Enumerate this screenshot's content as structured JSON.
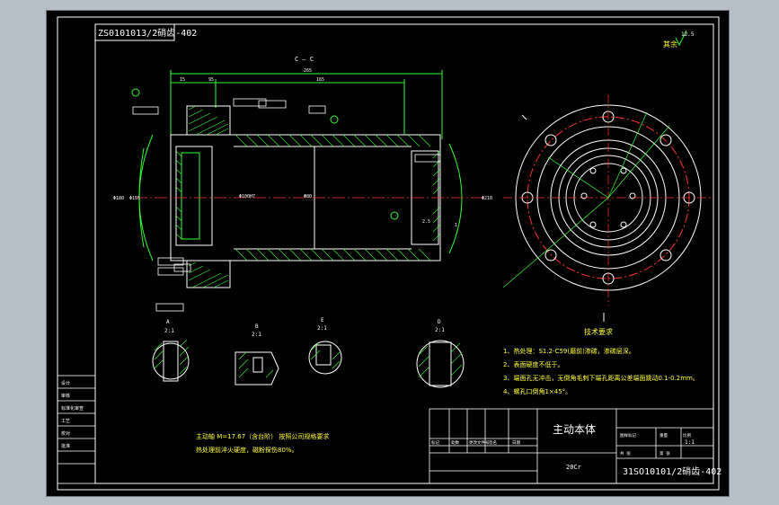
{
  "drawing": {
    "drawing_no_rotated": "ZS0101013/2硝齿-402",
    "section_label": "C — C",
    "roughness_other_label": "其余",
    "roughness_other_value": "12.5",
    "part_name": "主动本体",
    "material": "20Cr",
    "drawing_no": "31SO10101/2硝齿-402",
    "scale": "1:1",
    "tech_req_title": "技术要求",
    "tech_req": [
      "1、热处理：S1.2-C59(磨前)渗碳，渗碳层深。",
      "2、表面硬度不低于。",
      "3、端面孔无冲击，无倒角毛刺下端孔距离公差端面跳动0.1-0.2mm。",
      "4、螺孔口倒角1×45°。"
    ],
    "notes": [
      "主动轴  M=17.67（含台阶）  按照公司规格要求",
      "热处理前淬火硬度，磁粉探伤80%。"
    ],
    "detail_views": [
      {
        "id": "A",
        "scale": "2:1"
      },
      {
        "id": "B",
        "scale": "2:1"
      },
      {
        "id": "E",
        "scale": "2:1"
      },
      {
        "id": "D",
        "scale": "2:1"
      }
    ],
    "title_block_left": [
      "设计",
      "审核",
      "标准化审查",
      "工艺",
      "校对",
      "批准"
    ],
    "title_block_mid": [
      "标记",
      "处数",
      "更改文件号",
      "签名",
      "日期"
    ],
    "title_block_right": [
      "图样标记",
      "重量",
      "比例",
      "共 张",
      "第 张"
    ]
  },
  "colors": {
    "background": "#000000",
    "outline": "#ffffff",
    "geometry": "#33ff33",
    "dimension": "#33ff33",
    "text_yellow": "#ffff33",
    "center_line": "#ff3333",
    "hatch": "#33ff33",
    "window_gray": "#b7bfc6"
  }
}
